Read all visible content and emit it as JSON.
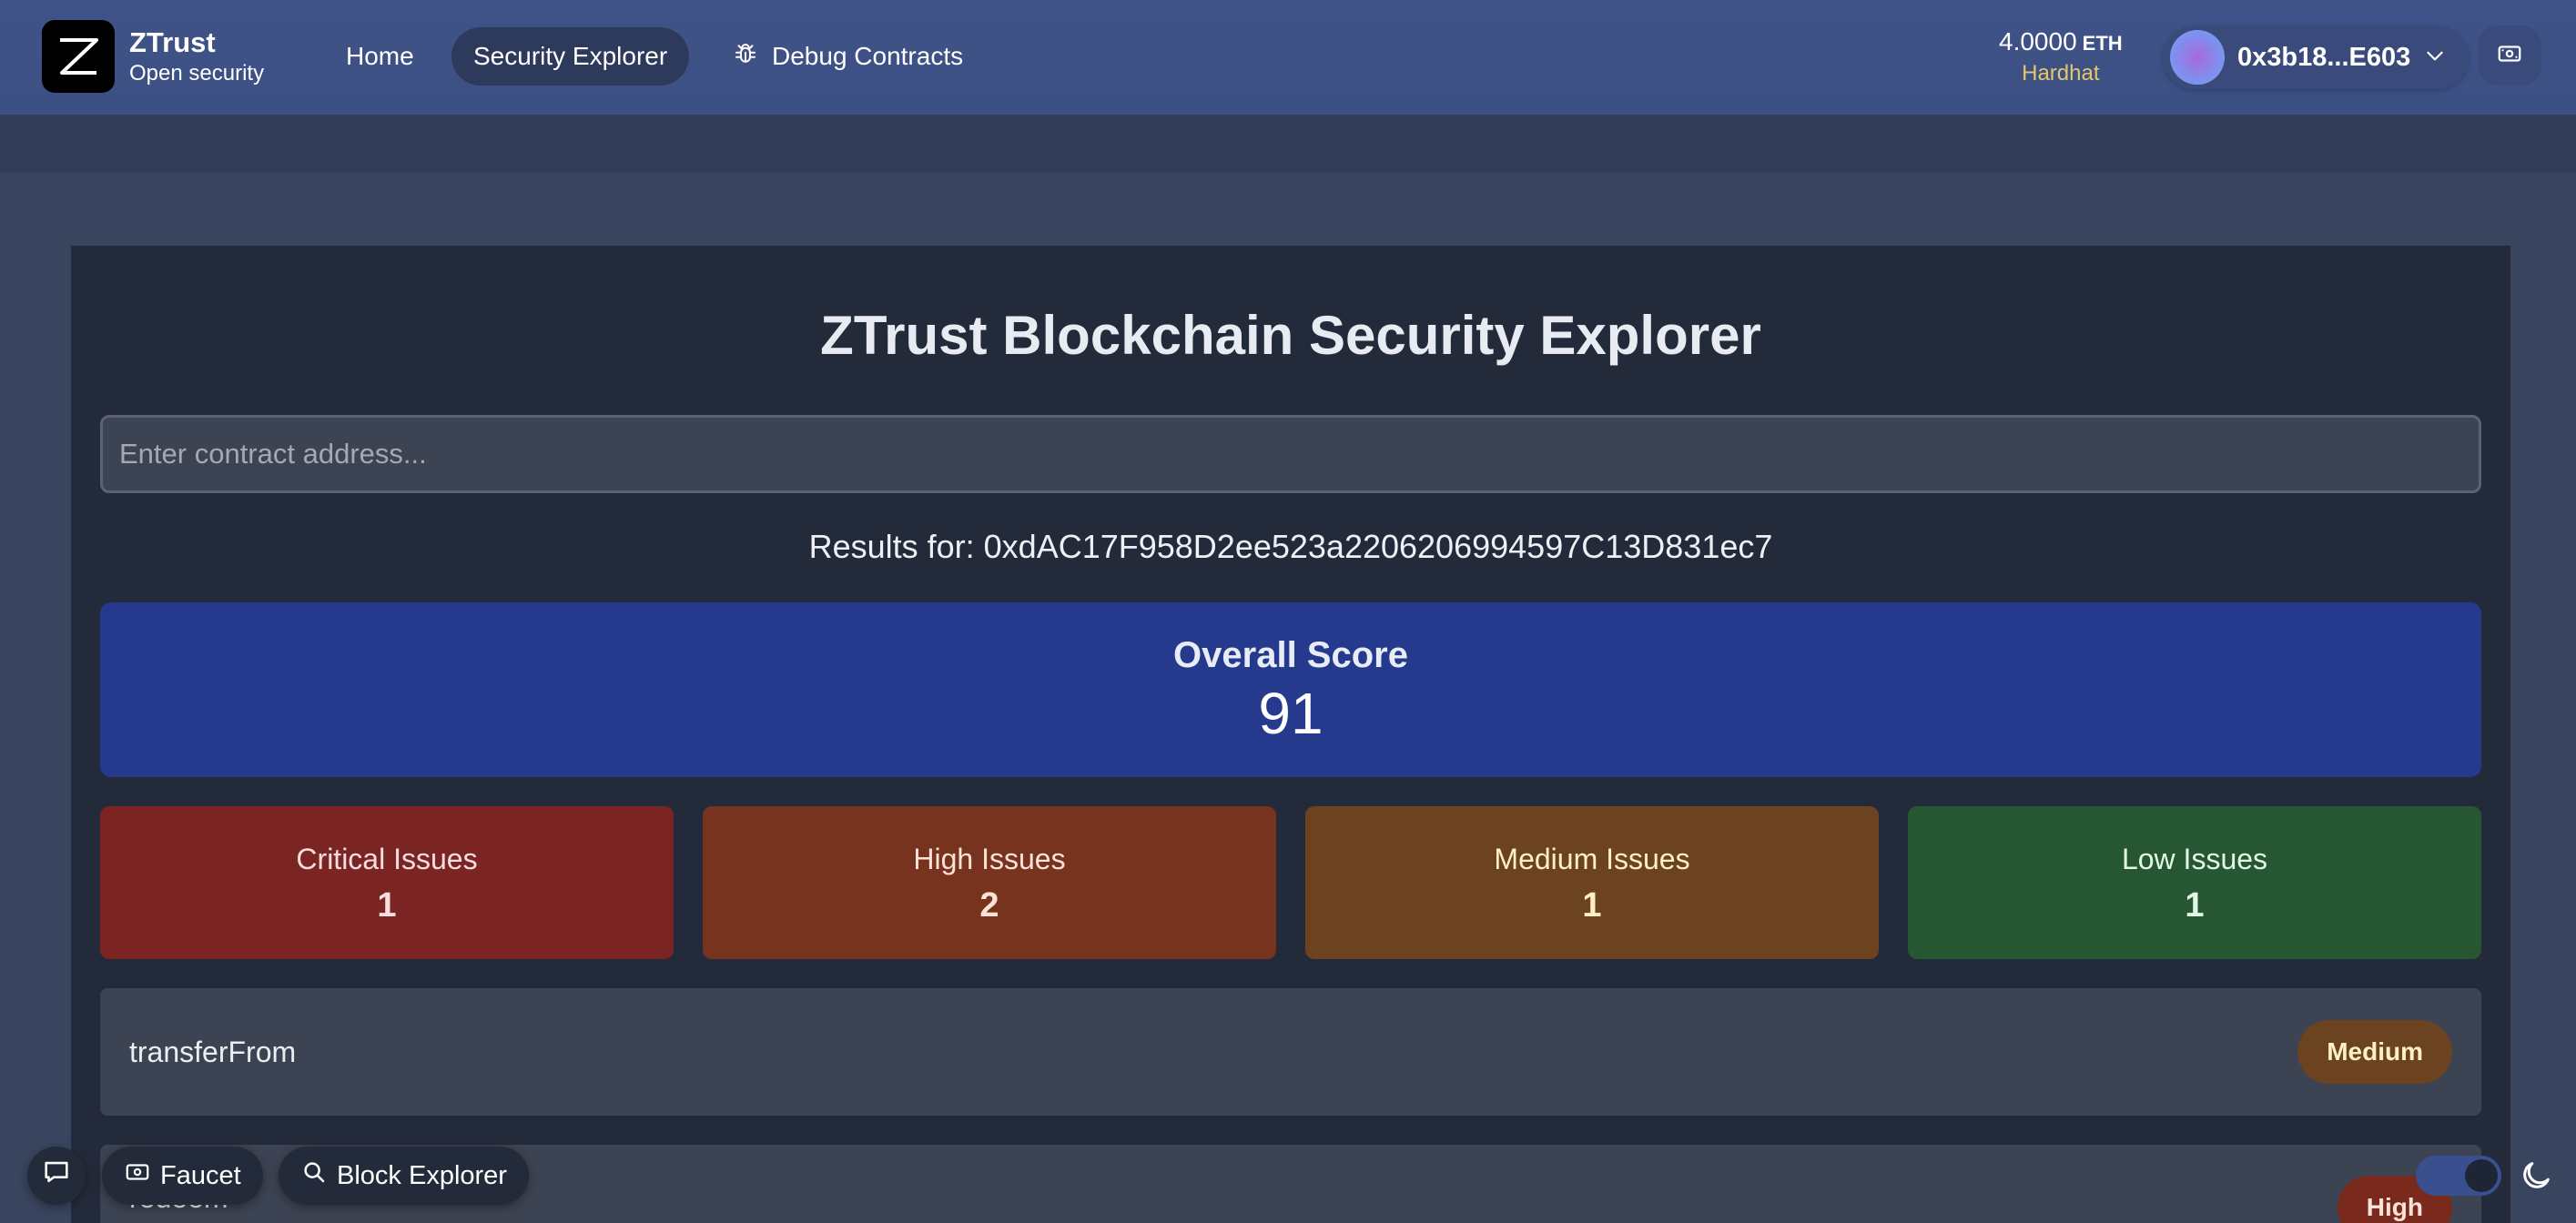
{
  "brand": {
    "name": "ZTrust",
    "tagline": "Open security"
  },
  "nav": {
    "home": "Home",
    "explorer": "Security Explorer",
    "debug": "Debug Contracts"
  },
  "wallet": {
    "balance": "4.0000",
    "unit": "ETH",
    "network": "Hardhat",
    "address": "0x3b18...E603"
  },
  "main": {
    "title": "ZTrust Blockchain Security Explorer",
    "search_placeholder": "Enter contract address...",
    "results_for": "Results for: 0xdAC17F958D2ee523a2206206994597C13D831ec7",
    "score": {
      "label": "Overall Score",
      "value": "91"
    },
    "issues": {
      "critical": {
        "label": "Critical Issues",
        "count": "1"
      },
      "high": {
        "label": "High Issues",
        "count": "2"
      },
      "medium": {
        "label": "Medium Issues",
        "count": "1"
      },
      "low": {
        "label": "Low Issues",
        "count": "1"
      }
    },
    "functions": [
      {
        "name": "transferFrom",
        "severity": "Medium"
      },
      {
        "name": "redeem",
        "severity": "High"
      }
    ]
  },
  "footer": {
    "faucet": "Faucet",
    "block_explorer": "Block Explorer"
  },
  "colors": {
    "header": "#3f5388",
    "panel": "#232a3a",
    "score_card": "#253a8c",
    "critical": "#7a2523",
    "high": "#78331e",
    "medium": "#6b4320",
    "low": "#275633"
  },
  "icons": [
    "logo-icon",
    "bug-icon",
    "chevron-down-icon",
    "wallet-icon",
    "chat-icon",
    "banknote-icon",
    "search-icon",
    "moon-icon"
  ]
}
